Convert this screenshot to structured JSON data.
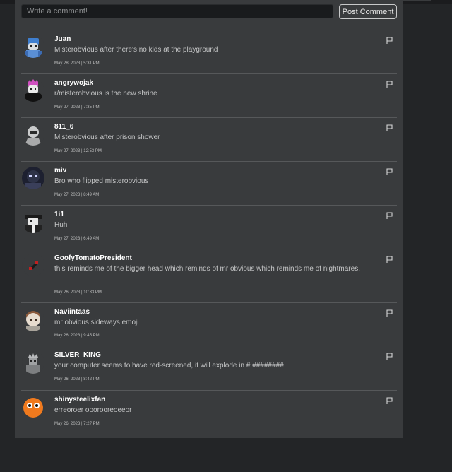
{
  "comment_input": {
    "placeholder": "Write a comment!"
  },
  "post_button_label": "Post Comment",
  "comments": [
    {
      "username": "Juan",
      "text": "Misterobvious after there's no kids at the playground",
      "timestamp": "May 28, 2023 | 5:31 PM"
    },
    {
      "username": "angrywojak",
      "text": "r/misterobvious is the new shrine",
      "timestamp": "May 27, 2023 | 7:35 PM"
    },
    {
      "username": "811_6",
      "text": "Misterobvious after prison shower",
      "timestamp": "May 27, 2023 | 12:53 PM"
    },
    {
      "username": "miv",
      "text": "Bro who flipped misterobvious",
      "timestamp": "May 27, 2023 | 8:49 AM"
    },
    {
      "username": "1i1",
      "text": "Huh",
      "timestamp": "May 27, 2023 | 6:49 AM"
    },
    {
      "username": "GoofyTomatoPresident",
      "text": "this reminds me of the bigger head which reminds of mr obvious which reminds me of nightmares.",
      "timestamp": "May 26, 2023 | 10:33 PM"
    },
    {
      "username": "Naviintaas",
      "text": "mr obvious sideways emoji",
      "timestamp": "May 26, 2023 | 9:45 PM"
    },
    {
      "username": "SILVER_KING",
      "text": "your computer seems to have red-screened, it will explode in # ########",
      "timestamp": "May 26, 2023 | 8:42 PM"
    },
    {
      "username": "shinysteelixfan",
      "text": "erreoroer ooorooreoeeor",
      "timestamp": "May 26, 2023 | 7:27 PM"
    }
  ],
  "icons": {
    "flag": "flag-icon"
  }
}
